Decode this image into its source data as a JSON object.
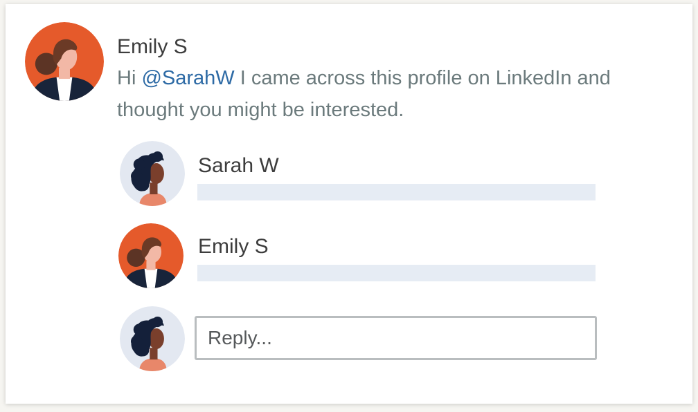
{
  "post": {
    "author": "Emily S",
    "text_prefix": "Hi ",
    "mention": "@SarahW",
    "text_suffix": " I came across this profile on LinkedIn and thought you might be interested."
  },
  "comments": [
    {
      "author": "Sarah W",
      "avatar": "sarah-avatar"
    },
    {
      "author": "Emily S",
      "avatar": "emily-avatar"
    }
  ],
  "reply": {
    "placeholder": "Reply...",
    "avatar": "sarah-avatar"
  },
  "colors": {
    "mention": "#2d6aa5",
    "emily_bg": "#e55a2b",
    "sarah_bg": "#e3e8f1",
    "placeholder_line": "#e6ecf4"
  }
}
